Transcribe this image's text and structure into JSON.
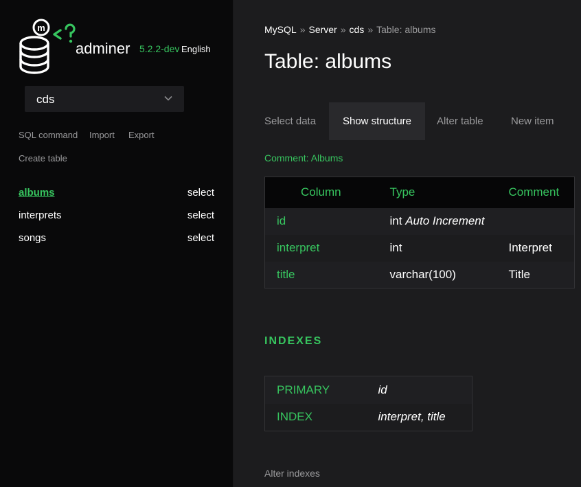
{
  "branding": {
    "logo_icon": "adminer-database-logo-icon",
    "name": "adminer",
    "version": "5.2.2-dev",
    "language": "English"
  },
  "sidebar": {
    "db_select": {
      "value": "cds",
      "icon": "chevron-down-icon"
    },
    "links": [
      "SQL command",
      "Import",
      "Export",
      "Create table"
    ],
    "tables": [
      {
        "name": "albums",
        "action": "select",
        "active": true
      },
      {
        "name": "interprets",
        "action": "select",
        "active": false
      },
      {
        "name": "songs",
        "action": "select",
        "active": false
      }
    ]
  },
  "breadcrumb": {
    "items": [
      "MySQL",
      "Server",
      "cds"
    ],
    "separator": "»",
    "current": "Table: albums"
  },
  "page": {
    "title": "Table: albums",
    "tabs": [
      "Select data",
      "Show structure",
      "Alter table",
      "New item"
    ],
    "active_tab": "Show structure",
    "comment": "Comment: Albums"
  },
  "columns_table": {
    "headers": [
      "Column",
      "Type",
      "Comment"
    ],
    "rows": [
      {
        "column": "id",
        "type": "int",
        "extra": "Auto Increment",
        "comment": ""
      },
      {
        "column": "interpret",
        "type": "int",
        "extra": "",
        "comment": "Interpret"
      },
      {
        "column": "title",
        "type": "varchar(100)",
        "extra": "",
        "comment": "Title"
      }
    ]
  },
  "indexes": {
    "heading": "INDEXES",
    "rows": [
      {
        "kind": "PRIMARY",
        "columns": "id"
      },
      {
        "kind": "INDEX",
        "columns": "interpret, title"
      }
    ],
    "alter_link": "Alter indexes"
  },
  "colors": {
    "accent": "#37c55f",
    "sidebar_bg": "#09090a",
    "main_bg": "#1c1c1e"
  }
}
